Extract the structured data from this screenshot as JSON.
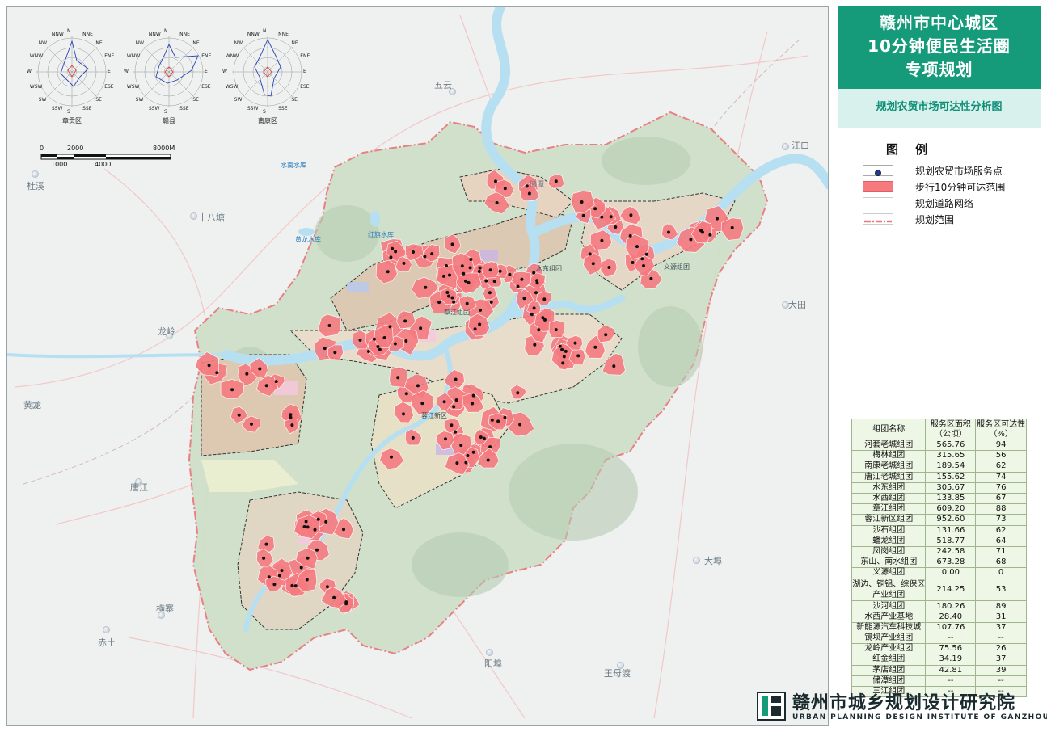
{
  "title": {
    "line1": "赣州市中心城区",
    "line2": "10分钟便民生活圈",
    "line3": "专项规划"
  },
  "subtitle": "规划农贸市场可达性分析图",
  "legend": {
    "title": "图 例",
    "items": [
      {
        "label": "规划农贸市场服务点",
        "icon": "service-point-icon"
      },
      {
        "label": "步行10分钟可达范围",
        "color": "#f47a7f"
      },
      {
        "label": "规划道路网络",
        "color": "#ffffff"
      },
      {
        "label": "规划范围",
        "color": "#e87a7e"
      }
    ]
  },
  "wind_roses": [
    {
      "name": "章贡区"
    },
    {
      "name": "赣县"
    },
    {
      "name": "南康区"
    }
  ],
  "wind_directions": [
    "N",
    "NNE",
    "NE",
    "ENE",
    "E",
    "ESE",
    "SE",
    "SSE",
    "S",
    "SSW",
    "SW",
    "WSW",
    "W",
    "WNW",
    "NW",
    "NNW"
  ],
  "scale_bar": {
    "top_labels": [
      "0",
      "2000",
      "8000M"
    ],
    "bottom_labels": [
      "1000",
      "4000"
    ]
  },
  "places": [
    {
      "name": "五云"
    },
    {
      "name": "江口"
    },
    {
      "name": "杜溪"
    },
    {
      "name": "十八塘"
    },
    {
      "name": "龙岭"
    },
    {
      "name": "黄龙"
    },
    {
      "name": "大田"
    },
    {
      "name": "唐江"
    },
    {
      "name": "横寨"
    },
    {
      "name": "大埠"
    },
    {
      "name": "赤土"
    },
    {
      "name": "阳埠"
    },
    {
      "name": "王母渡"
    },
    {
      "name": "储潭"
    }
  ],
  "map_labels": {
    "reservoir_1": "水南水库",
    "reservoir_2": "黄龙水库",
    "reservoir_3": "红旗水库",
    "district_1": "水东组团",
    "district_2": "义源组团",
    "district_3": "章江组团",
    "district_4": "蓉江新区"
  },
  "table": {
    "headers": [
      "组团名称",
      "服务区面积（公顷）",
      "服务区可达性（%）"
    ],
    "rows": [
      [
        "河套老城组团",
        "565.76",
        "94"
      ],
      [
        "梅林组团",
        "315.65",
        "56"
      ],
      [
        "南康老城组团",
        "189.54",
        "62"
      ],
      [
        "唐江老城组团",
        "155.62",
        "74"
      ],
      [
        "水东组团",
        "305.67",
        "76"
      ],
      [
        "水西组团",
        "133.85",
        "67"
      ],
      [
        "章江组团",
        "609.20",
        "88"
      ],
      [
        "蓉江新区组团",
        "952.60",
        "73"
      ],
      [
        "沙石组团",
        "131.66",
        "62"
      ],
      [
        "蟠龙组团",
        "518.77",
        "64"
      ],
      [
        "凤岗组团",
        "242.58",
        "71"
      ],
      [
        "东山、南水组团",
        "673.28",
        "68"
      ],
      [
        "义源组团",
        "0.00",
        "0"
      ],
      [
        "湖边、铜铝、综保区产业组团",
        "214.25",
        "53"
      ],
      [
        "沙河组团",
        "180.26",
        "89"
      ],
      [
        "水西产业基地",
        "28.40",
        "31"
      ],
      [
        "新能源汽车科技城",
        "107.76",
        "37"
      ],
      [
        "镜坝产业组团",
        "--",
        "--"
      ],
      [
        "龙岭产业组团",
        "75.56",
        "26"
      ],
      [
        "红金组团",
        "34.19",
        "37"
      ],
      [
        "茅店组团",
        "42.81",
        "39"
      ],
      [
        "储潭组团",
        "--",
        "--"
      ],
      [
        "三江组团",
        "--",
        "--"
      ]
    ]
  },
  "institute": {
    "name_cn": "赣州市城乡规划设计研究院",
    "name_en": "URBAN PLANNING DESIGN INSTITUTE OF GANZHOU"
  },
  "colors": {
    "brand_green": "#159b7a",
    "subtitle_bg": "#d9f1ec",
    "service_area": "#f47a7f",
    "river": "#b6dff2",
    "terrain": "#cfe0c8"
  }
}
